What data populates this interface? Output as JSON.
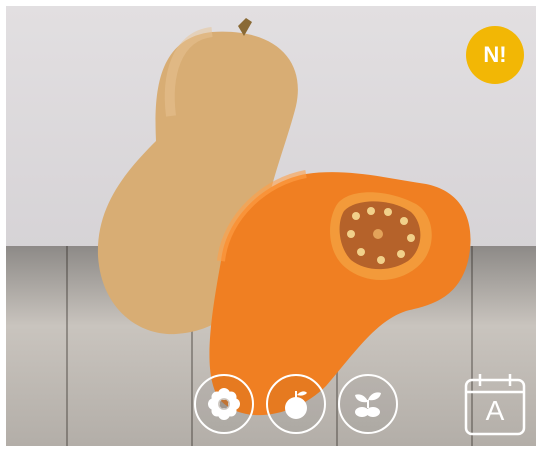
{
  "badge": {
    "text": "N!",
    "color": "#f2b705"
  },
  "icons": [
    {
      "name": "flower-icon"
    },
    {
      "name": "fruit-icon"
    },
    {
      "name": "seedling-icon"
    }
  ],
  "calendar": {
    "letter": "A",
    "icon": "calendar-icon"
  }
}
